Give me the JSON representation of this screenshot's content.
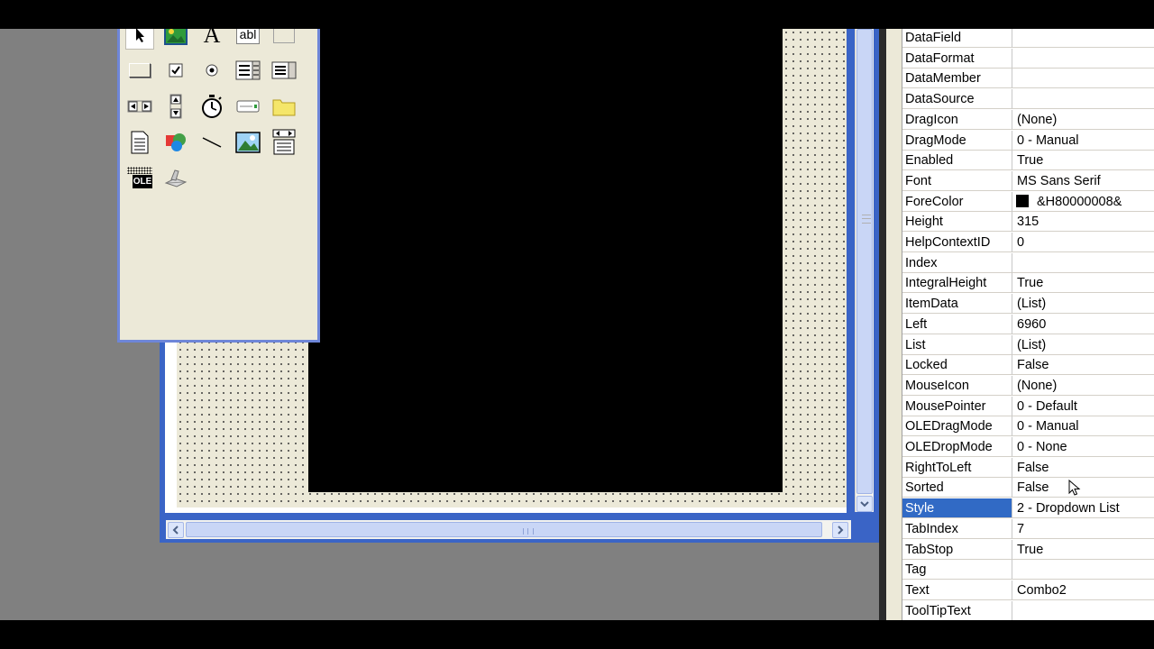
{
  "toolbox": {
    "tools": [
      {
        "id": "pointer",
        "label": ""
      },
      {
        "id": "picturebox",
        "label": ""
      },
      {
        "id": "label",
        "label": "A"
      },
      {
        "id": "textbox",
        "label": "abl"
      },
      {
        "id": "frame",
        "label": ""
      },
      {
        "id": "commandbutton",
        "label": ""
      },
      {
        "id": "checkbox",
        "label": ""
      },
      {
        "id": "optionbutton",
        "label": ""
      },
      {
        "id": "combobox",
        "label": ""
      },
      {
        "id": "listbox",
        "label": ""
      },
      {
        "id": "hscrollbar",
        "label": ""
      },
      {
        "id": "vscrollbar",
        "label": ""
      },
      {
        "id": "timer",
        "label": ""
      },
      {
        "id": "drivelistbox",
        "label": ""
      },
      {
        "id": "dirlistbox",
        "label": ""
      },
      {
        "id": "filelistbox",
        "label": ""
      },
      {
        "id": "shape",
        "label": ""
      },
      {
        "id": "line",
        "label": ""
      },
      {
        "id": "image",
        "label": ""
      },
      {
        "id": "data",
        "label": ""
      },
      {
        "id": "ole",
        "label": "OLE"
      },
      {
        "id": "scanner",
        "label": ""
      }
    ]
  },
  "properties": {
    "rows": [
      {
        "name": "DataField",
        "value": ""
      },
      {
        "name": "DataFormat",
        "value": ""
      },
      {
        "name": "DataMember",
        "value": ""
      },
      {
        "name": "DataSource",
        "value": ""
      },
      {
        "name": "DragIcon",
        "value": "(None)"
      },
      {
        "name": "DragMode",
        "value": "0 - Manual"
      },
      {
        "name": "Enabled",
        "value": "True"
      },
      {
        "name": "Font",
        "value": "MS Sans Serif"
      },
      {
        "name": "ForeColor",
        "value": "&H80000008&",
        "swatch": "#000000"
      },
      {
        "name": "Height",
        "value": "315"
      },
      {
        "name": "HelpContextID",
        "value": "0"
      },
      {
        "name": "Index",
        "value": ""
      },
      {
        "name": "IntegralHeight",
        "value": "True"
      },
      {
        "name": "ItemData",
        "value": "(List)"
      },
      {
        "name": "Left",
        "value": "6960"
      },
      {
        "name": "List",
        "value": "(List)"
      },
      {
        "name": "Locked",
        "value": "False"
      },
      {
        "name": "MouseIcon",
        "value": "(None)"
      },
      {
        "name": "MousePointer",
        "value": "0 - Default"
      },
      {
        "name": "OLEDragMode",
        "value": "0 - Manual"
      },
      {
        "name": "OLEDropMode",
        "value": "0 - None"
      },
      {
        "name": "RightToLeft",
        "value": "False"
      },
      {
        "name": "Sorted",
        "value": "False"
      },
      {
        "name": "Style",
        "value": "2 - Dropdown List",
        "selected": true
      },
      {
        "name": "TabIndex",
        "value": "7"
      },
      {
        "name": "TabStop",
        "value": "True"
      },
      {
        "name": "Tag",
        "value": ""
      },
      {
        "name": "Text",
        "value": "Combo2"
      },
      {
        "name": "ToolTipText",
        "value": ""
      }
    ]
  },
  "colors": {
    "selection": "#316ac5",
    "designer_border": "#3a64c6",
    "form_background": "#ece9d8"
  }
}
